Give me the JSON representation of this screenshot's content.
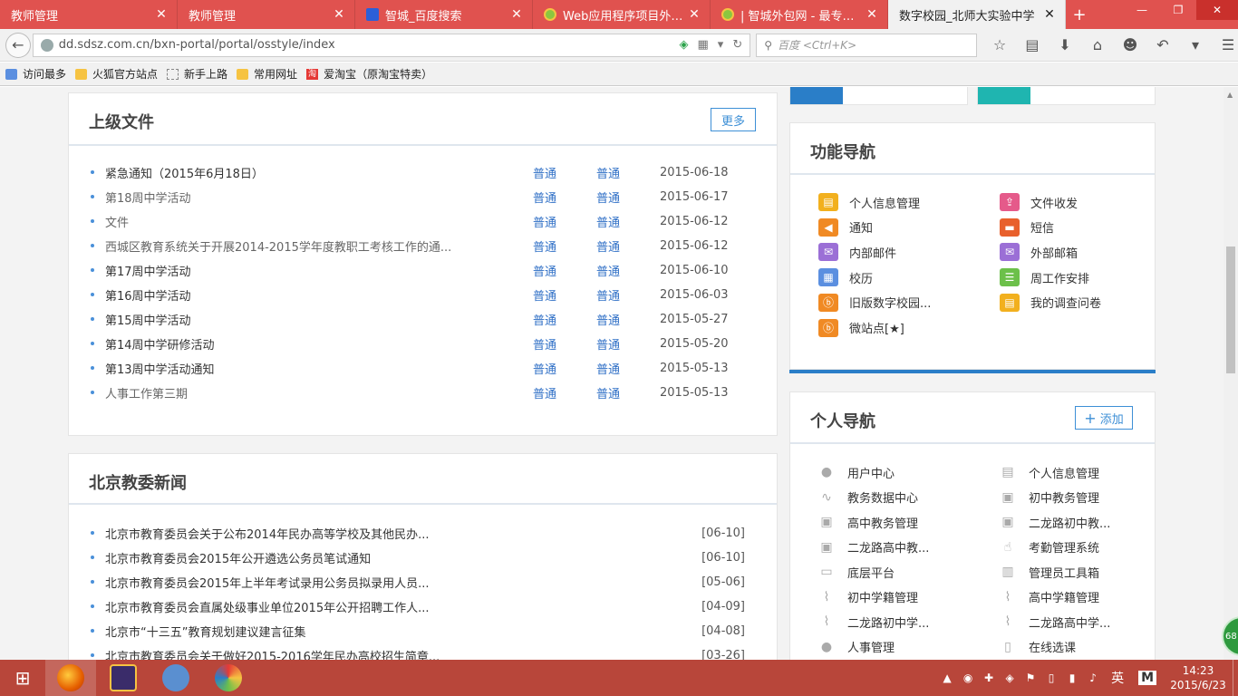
{
  "browser": {
    "tabs": [
      {
        "label": "教师管理",
        "active": false
      },
      {
        "label": "教师管理",
        "active": false
      },
      {
        "label": "智城_百度搜索",
        "active": false
      },
      {
        "label": "Web应用程序项目外包...",
        "active": false
      },
      {
        "label": "| 智城外包网 - 最专业的...",
        "active": false
      },
      {
        "label": "数字校园_北师大实验中学",
        "active": true
      }
    ],
    "new_tab": "+",
    "url": "dd.sdsz.com.cn/bxn-portal/portal/osstyle/index",
    "search_placeholder": "百度 <Ctrl+K>",
    "bookmarks": [
      {
        "label": "访问最多",
        "icon": "folder-icon"
      },
      {
        "label": "火狐官方站点",
        "icon": "folder-icon"
      },
      {
        "label": "新手上路",
        "icon": "page-icon"
      },
      {
        "label": "常用网址",
        "icon": "folder-icon"
      },
      {
        "label": "爱淘宝（原淘宝特卖）",
        "icon": "taobao-icon"
      }
    ]
  },
  "superior_docs": {
    "title": "上级文件",
    "more_label": "更多",
    "rows": [
      {
        "title": "紧急通知（2015年6月18日）",
        "level1": "普通",
        "level2": "普通",
        "date": "2015-06-18",
        "read": false
      },
      {
        "title": "第18周中学活动",
        "level1": "普通",
        "level2": "普通",
        "date": "2015-06-17",
        "read": true
      },
      {
        "title": "文件",
        "level1": "普通",
        "level2": "普通",
        "date": "2015-06-12",
        "read": true
      },
      {
        "title": "西城区教育系统关于开展2014-2015学年度教职工考核工作的通...",
        "level1": "普通",
        "level2": "普通",
        "date": "2015-06-12",
        "read": true
      },
      {
        "title": "第17周中学活动",
        "level1": "普通",
        "level2": "普通",
        "date": "2015-06-10",
        "read": false
      },
      {
        "title": "第16周中学活动",
        "level1": "普通",
        "level2": "普通",
        "date": "2015-06-03",
        "read": false
      },
      {
        "title": "第15周中学活动",
        "level1": "普通",
        "level2": "普通",
        "date": "2015-05-27",
        "read": false
      },
      {
        "title": "第14周中学研修活动",
        "level1": "普通",
        "level2": "普通",
        "date": "2015-05-20",
        "read": false
      },
      {
        "title": "第13周中学活动通知",
        "level1": "普通",
        "level2": "普通",
        "date": "2015-05-13",
        "read": false
      },
      {
        "title": "人事工作第三期",
        "level1": "普通",
        "level2": "普通",
        "date": "2015-05-13",
        "read": true
      }
    ]
  },
  "news": {
    "title": "北京教委新闻",
    "rows": [
      {
        "title": "北京市教育委员会关于公布2014年民办高等学校及其他民办...",
        "date": "[06-10]"
      },
      {
        "title": "北京市教育委员会2015年公开遴选公务员笔试通知",
        "date": "[06-10]"
      },
      {
        "title": "北京市教育委员会2015年上半年考试录用公务员拟录用人员...",
        "date": "[05-06]"
      },
      {
        "title": "北京市教育委员会直属处级事业单位2015年公开招聘工作人...",
        "date": "[04-09]"
      },
      {
        "title": "北京市“十三五”教育规划建议建言征集",
        "date": "[04-08]"
      },
      {
        "title": "北京市教育委员会关于做好2015-2016学年民办高校招生简章...",
        "date": "[03-26]"
      }
    ]
  },
  "function_nav": {
    "title": "功能导航",
    "items": [
      {
        "label": "个人信息管理",
        "icon": "id-card-icon",
        "color": "#f2b01e"
      },
      {
        "label": "文件收发",
        "icon": "upload-icon",
        "color": "#e55a8a"
      },
      {
        "label": "通知",
        "icon": "speaker-icon",
        "color": "#f08a24"
      },
      {
        "label": "短信",
        "icon": "chat-icon",
        "color": "#e8602c"
      },
      {
        "label": "内部邮件",
        "icon": "mail-icon",
        "color": "#9b6fd6"
      },
      {
        "label": "外部邮箱",
        "icon": "mail-icon",
        "color": "#9b6fd6"
      },
      {
        "label": "校历",
        "icon": "calendar-icon",
        "color": "#5b8fe0"
      },
      {
        "label": "周工作安排",
        "icon": "list-icon",
        "color": "#6cc04a"
      },
      {
        "label": "旧版数字校园...",
        "icon": "orange-b-icon",
        "color": "#f08a24"
      },
      {
        "label": "我的调查问卷",
        "icon": "id-card-icon",
        "color": "#f2b01e"
      },
      {
        "label": "微站点[★]",
        "icon": "orange-b-icon",
        "color": "#f08a24"
      }
    ]
  },
  "personal_nav": {
    "title": "个人导航",
    "add_label": "添加",
    "items": [
      {
        "label": "用户中心",
        "icon": "user-icon"
      },
      {
        "label": "个人信息管理",
        "icon": "id-card-icon"
      },
      {
        "label": "教务数据中心",
        "icon": "chart-line-icon"
      },
      {
        "label": "初中教务管理",
        "icon": "monitor-icon"
      },
      {
        "label": "高中教务管理",
        "icon": "monitor-icon"
      },
      {
        "label": "二龙路初中教...",
        "icon": "monitor-icon"
      },
      {
        "label": "二龙路高中教...",
        "icon": "monitor-icon"
      },
      {
        "label": "考勤管理系统",
        "icon": "finger-icon"
      },
      {
        "label": "底层平台",
        "icon": "desktop-icon"
      },
      {
        "label": "管理员工具箱",
        "icon": "toolbox-icon"
      },
      {
        "label": "初中学籍管理",
        "icon": "paperclip-icon"
      },
      {
        "label": "高中学籍管理",
        "icon": "paperclip-icon"
      },
      {
        "label": "二龙路初中学...",
        "icon": "paperclip-icon"
      },
      {
        "label": "二龙路高中学...",
        "icon": "paperclip-icon"
      },
      {
        "label": "人事管理",
        "icon": "user-settings-icon"
      },
      {
        "label": "在线选课",
        "icon": "clipboard-icon"
      }
    ]
  },
  "side_badge": "68",
  "taskbar": {
    "ime": "英",
    "ime2": "M",
    "time": "14:23",
    "date": "2015/6/23",
    "apps": [
      {
        "name": "firefox-app",
        "color": "#e66000"
      },
      {
        "name": "javaee-ide-app",
        "color": "#3a2c6a",
        "label": "Java EE IDE"
      },
      {
        "name": "dolphin-app",
        "color": "#5a8fd0"
      },
      {
        "name": "paint-app",
        "color": "#7ea6d8"
      }
    ]
  }
}
